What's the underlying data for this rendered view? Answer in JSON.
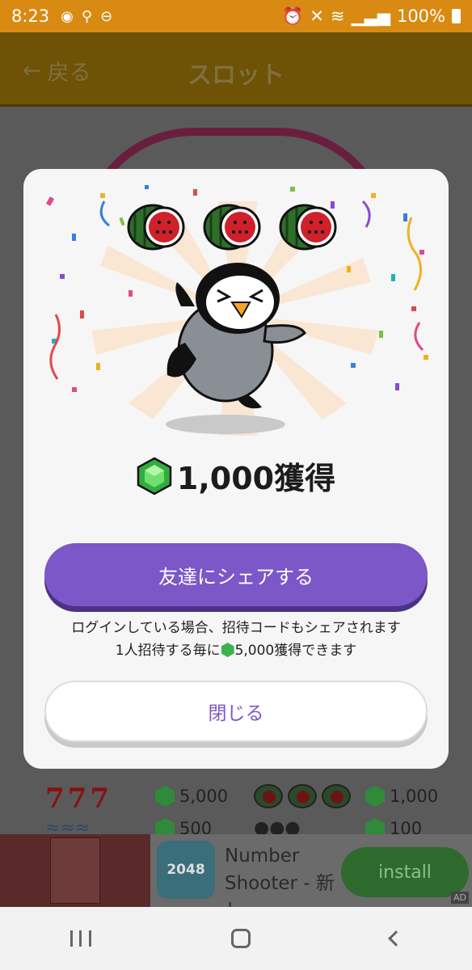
{
  "status_bar": {
    "time": "8:23",
    "battery": "100%"
  },
  "app_bar": {
    "back_label": "戻る",
    "title": "スロット"
  },
  "dialog": {
    "reward_text": "1,000獲得",
    "share_button": "友達にシェアする",
    "note_line1": "ログインしている場合、招待コードもシェアされます",
    "note_line2_prefix": "1人招待する毎に",
    "note_line2_suffix": "5,000獲得できます",
    "close_button": "閉じる"
  },
  "paytable": {
    "rows": [
      {
        "left_symbol": "777",
        "left_value": "5,000",
        "right_symbol": "watermelon",
        "right_value": "1,000"
      },
      {
        "left_symbol": "fish",
        "left_value": "500",
        "right_symbol": "penguin",
        "right_value": "100"
      }
    ]
  },
  "ad": {
    "app_icon_text": "2048",
    "title": "Number Shooter - 新し...",
    "install_label": "install",
    "tag": "AD"
  },
  "colors": {
    "accent_purple": "#7c57c7",
    "status_orange": "#d98a12",
    "gem_green": "#3bb34a"
  }
}
